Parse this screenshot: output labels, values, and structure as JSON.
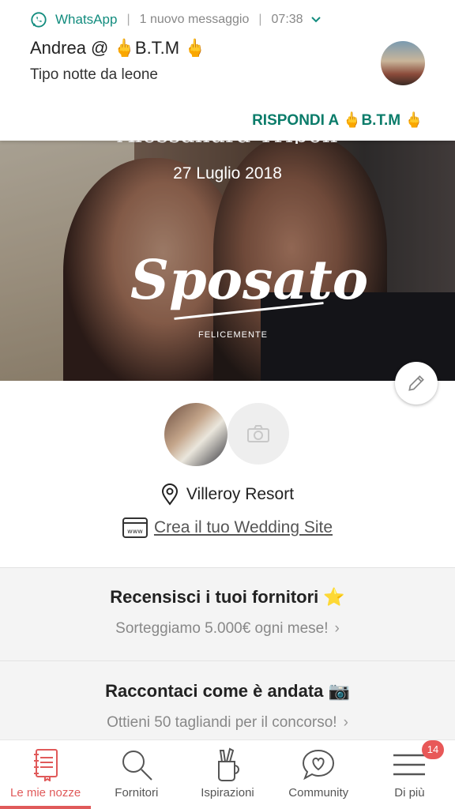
{
  "notification": {
    "app": "WhatsApp",
    "summary": "1 nuovo messaggio",
    "time": "07:38",
    "title": "Andrea @ 🖕B.T.M 🖕",
    "body": "Tipo notte da leone",
    "action": "RISPONDI A 🖕B.T.M 🖕"
  },
  "hero": {
    "names": "Alessandra Tripoli",
    "date": "27 Luglio 2018",
    "badge_title": "Sposato",
    "badge_sub": "FELICEMENTE"
  },
  "profile": {
    "venue": "Villeroy Resort",
    "wedding_site": "Crea il tuo Wedding Site"
  },
  "cards": [
    {
      "title": "Recensisci i tuoi fornitori ⭐",
      "subtitle": "Sorteggiamo 5.000€ ogni mese!"
    },
    {
      "title": "Raccontaci come è andata 📷",
      "subtitle": "Ottieni 50 tagliandi per il concorso!"
    }
  ],
  "bottom_nav": {
    "items": [
      {
        "label": "Le mie nozze",
        "icon": "notebook-icon",
        "active": true
      },
      {
        "label": "Fornitori",
        "icon": "search-icon"
      },
      {
        "label": "Ispirazioni",
        "icon": "pencil-cup-icon"
      },
      {
        "label": "Community",
        "icon": "heart-chat-icon"
      },
      {
        "label": "Di più",
        "icon": "menu-icon",
        "badge": "14"
      }
    ]
  },
  "colors": {
    "accent": "#e05a5a",
    "whatsapp": "#128c7e",
    "action": "#0b7c6a"
  }
}
